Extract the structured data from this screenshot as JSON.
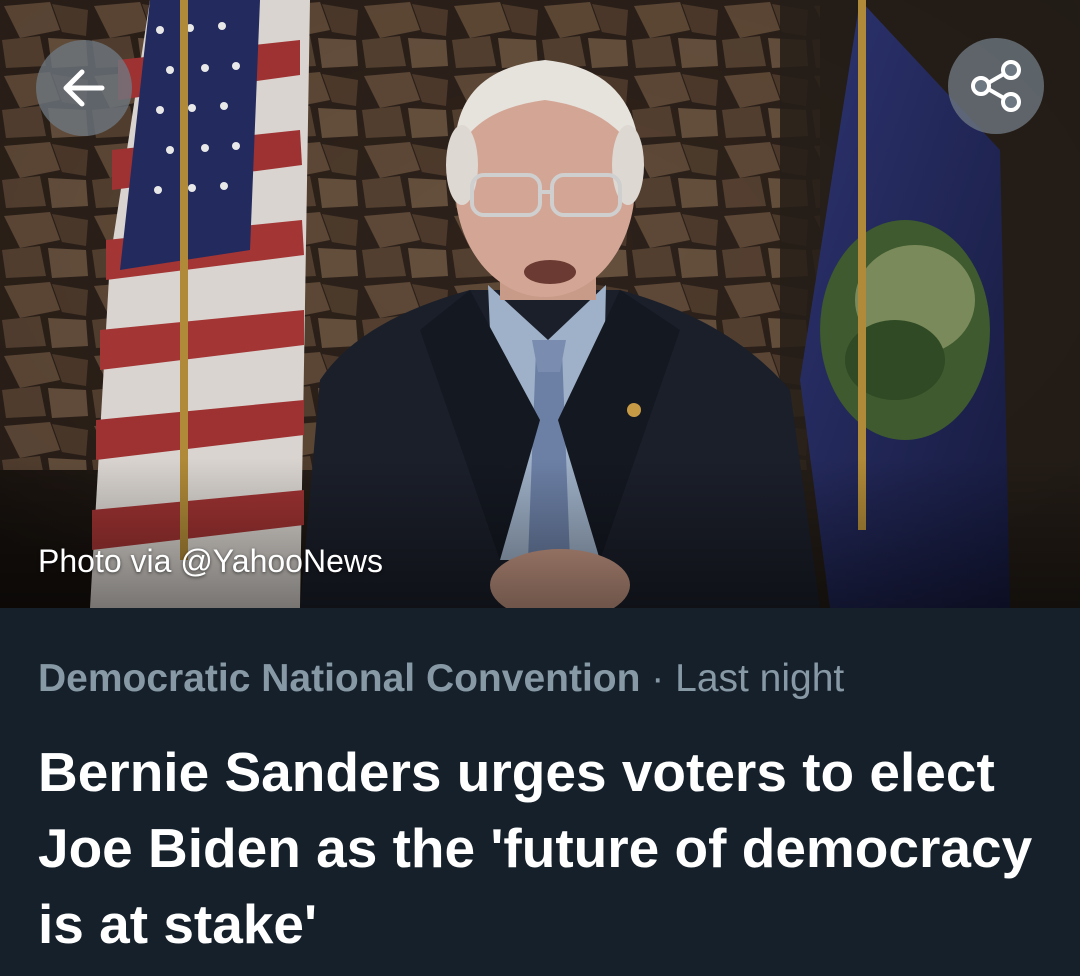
{
  "hero": {
    "photo_credit": "Photo via @YahooNews"
  },
  "buttons": {
    "back_icon": "arrow-left-icon",
    "share_icon": "share-icon"
  },
  "article": {
    "category": "Democratic National Convention",
    "separator": "·",
    "time": "Last night",
    "headline": "Bernie Sanders urges voters to elect Joe Biden as the 'future of democracy is at stake'"
  },
  "colors": {
    "background": "#15202b",
    "meta_text": "#8899a6",
    "headline_text": "#ffffff",
    "button_fill": "#6e7882"
  }
}
